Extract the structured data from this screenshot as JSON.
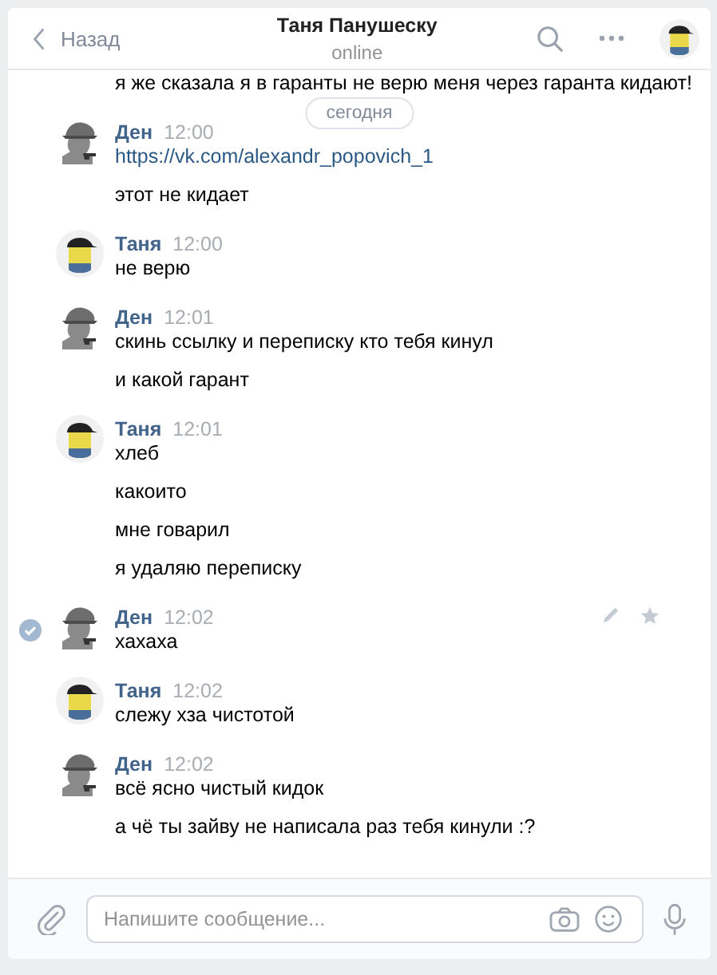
{
  "header": {
    "back": "Назад",
    "title": "Таня Панушеску",
    "status": "online"
  },
  "clipped_message": "я же сказала я в гаранты не верю меня через гаранта кидают!",
  "date_divider": "сегодня",
  "messages": [
    {
      "author": "Ден",
      "time": "12:00",
      "kind": "den",
      "selected": false,
      "lines": [
        {
          "kind": "link",
          "text": "https://vk.com/alexandr_popovich_1"
        },
        {
          "kind": "text",
          "text": "этот не кидает"
        }
      ]
    },
    {
      "author": "Таня",
      "time": "12:00",
      "kind": "tanya",
      "selected": false,
      "lines": [
        {
          "kind": "text",
          "text": "не верю"
        }
      ]
    },
    {
      "author": "Ден",
      "time": "12:01",
      "kind": "den",
      "selected": false,
      "lines": [
        {
          "kind": "text",
          "text": "скинь ссылку и переписку кто тебя кинул"
        },
        {
          "kind": "text",
          "text": "и какой гарант"
        }
      ]
    },
    {
      "author": "Таня",
      "time": "12:01",
      "kind": "tanya",
      "selected": false,
      "lines": [
        {
          "kind": "text",
          "text": "хлеб"
        },
        {
          "kind": "text",
          "text": "какоито"
        },
        {
          "kind": "text",
          "text": "мне говарил"
        },
        {
          "kind": "text",
          "text": "я удаляю переписку"
        }
      ]
    },
    {
      "author": "Ден",
      "time": "12:02",
      "kind": "den",
      "selected": true,
      "lines": [
        {
          "kind": "text",
          "text": "хахаха"
        }
      ]
    },
    {
      "author": "Таня",
      "time": "12:02",
      "kind": "tanya",
      "selected": false,
      "lines": [
        {
          "kind": "text",
          "text": "слежу хза чистотой"
        }
      ]
    },
    {
      "author": "Ден",
      "time": "12:02",
      "kind": "den",
      "selected": false,
      "lines": [
        {
          "kind": "text",
          "text": "всё ясно чистый кидок"
        },
        {
          "kind": "text",
          "text": "а чё ты зайву не написала раз тебя кинули :?"
        }
      ]
    }
  ],
  "composer": {
    "placeholder": "Напишите сообщение..."
  }
}
